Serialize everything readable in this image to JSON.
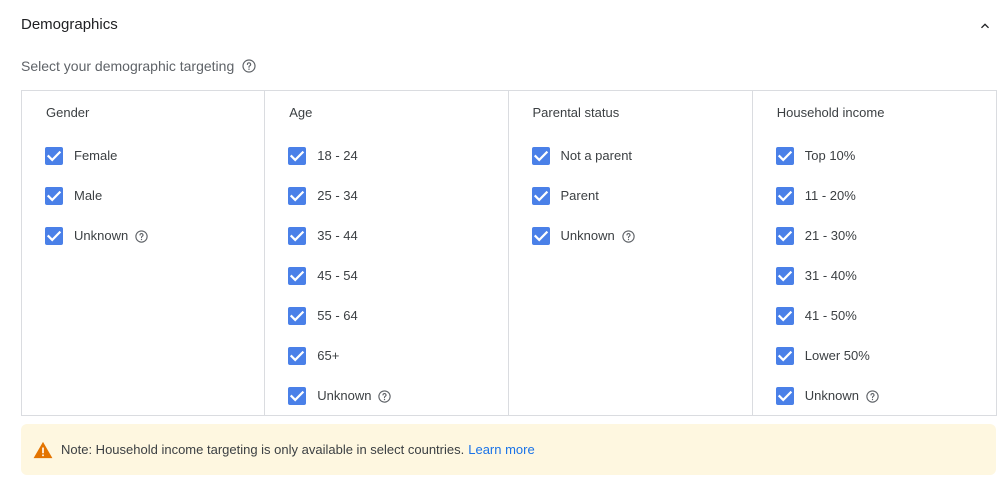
{
  "section": {
    "title": "Demographics",
    "subtitle": "Select your demographic targeting"
  },
  "icons": {
    "collapse": "chevron-up-icon",
    "help": "help-outline-icon",
    "checkbox": "checkbox-checked-icon",
    "warning": "warning-icon"
  },
  "colors": {
    "checkbox": "#4a80e8",
    "border": "#dadce0",
    "note_bg": "#fef7e0",
    "warning": "#e37400",
    "link": "#1a73e8"
  },
  "columns": [
    {
      "title": "Gender",
      "options": [
        {
          "label": "Female",
          "checked": true,
          "help": false
        },
        {
          "label": "Male",
          "checked": true,
          "help": false
        },
        {
          "label": "Unknown",
          "checked": true,
          "help": true
        }
      ]
    },
    {
      "title": "Age",
      "options": [
        {
          "label": "18 - 24",
          "checked": true,
          "help": false
        },
        {
          "label": "25 - 34",
          "checked": true,
          "help": false
        },
        {
          "label": "35 - 44",
          "checked": true,
          "help": false
        },
        {
          "label": "45 - 54",
          "checked": true,
          "help": false
        },
        {
          "label": "55 - 64",
          "checked": true,
          "help": false
        },
        {
          "label": "65+",
          "checked": true,
          "help": false
        },
        {
          "label": "Unknown",
          "checked": true,
          "help": true
        }
      ]
    },
    {
      "title": "Parental status",
      "options": [
        {
          "label": "Not a parent",
          "checked": true,
          "help": false
        },
        {
          "label": "Parent",
          "checked": true,
          "help": false
        },
        {
          "label": "Unknown",
          "checked": true,
          "help": true
        }
      ]
    },
    {
      "title": "Household income",
      "options": [
        {
          "label": "Top 10%",
          "checked": true,
          "help": false
        },
        {
          "label": "11 - 20%",
          "checked": true,
          "help": false
        },
        {
          "label": "21 - 30%",
          "checked": true,
          "help": false
        },
        {
          "label": "31 - 40%",
          "checked": true,
          "help": false
        },
        {
          "label": "41 - 50%",
          "checked": true,
          "help": false
        },
        {
          "label": "Lower 50%",
          "checked": true,
          "help": false
        },
        {
          "label": "Unknown",
          "checked": true,
          "help": true
        }
      ]
    }
  ],
  "note": {
    "text": "Note: Household income targeting is only available in select countries.",
    "link": "Learn more"
  }
}
